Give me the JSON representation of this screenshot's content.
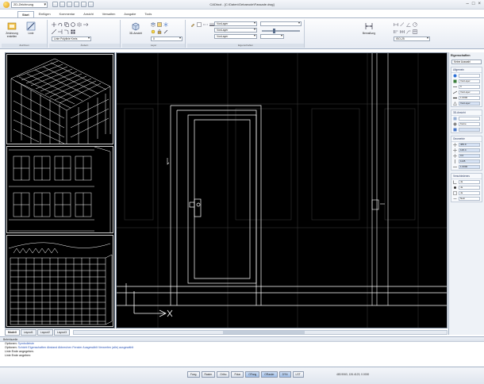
{
  "titlebar": {
    "workspace": "2D-Zeichnung",
    "title": "CADtool - [C:\\Daten\\Gebaeude\\Fassade.dwg]"
  },
  "ribbon": {
    "tabs": [
      "Start",
      "Einfügen",
      "Kommentar",
      "Ansicht",
      "Verwalten",
      "Ausgabe",
      "Tools"
    ],
    "active_tab": "Start",
    "groups": {
      "draw": {
        "title": "Zeichnen",
        "big1": "Zeichnung erstellen",
        "big2": "Linie"
      },
      "modify": {
        "title": "Ändern",
        "label": "Linie Polylinie Kreis"
      },
      "layer": {
        "title": "Layer",
        "big": "3D-Ansicht"
      },
      "properties": {
        "title": "Eigenschaften",
        "combo1": "0",
        "combo2": "VonLayer",
        "combo3": "VonLayer",
        "combo4": "VonLayer"
      },
      "annotation": {
        "big": "Bemaßung",
        "combo": "ISO-25"
      }
    }
  },
  "layout_tabs": [
    "Modell",
    "Layout1",
    "Layout2",
    "Layout3"
  ],
  "palette": {
    "title": "Eigenschaften",
    "selector": "Keine Auswahl",
    "sections": [
      {
        "title": "Allgemein",
        "rows": [
          "",
          "VonLayer",
          "0",
          "VonLayer",
          "1.0000",
          "VonLayer"
        ]
      },
      {
        "title": "3D-Ansicht",
        "rows": [
          "",
          "Keine",
          ""
        ]
      },
      {
        "title": "Geometrie",
        "rows": [
          "483.9",
          "126.4",
          "0.0",
          "1145",
          "1.0000"
        ]
      },
      {
        "title": "Verschiedenes",
        "rows": [
          "Ja",
          "Ja",
          "Ja",
          "Nein"
        ]
      }
    ]
  },
  "command": {
    "header": "Befehlszeile",
    "line1_prefix": "Optionen:",
    "line1_opts": "Symbolleiste",
    "line2_prefix": "Optionen:",
    "line2_opts": "Schicht Eigenschaften Abstand Abbrechen Fenster Ausgewählt Verwerfen (alle) ausgewählt",
    "line3": "Linie Ende angegeben.",
    "line4": "Linie Ende angeben:"
  },
  "status": {
    "buttons": [
      "Fang",
      "Raster",
      "Ortho",
      "Polar",
      "OFang",
      "ORaster",
      "DYN",
      "LST"
    ],
    "active": [
      "OFang",
      "ORaster",
      "DYN"
    ],
    "coords": "483.9063, 126.4123, 0.0000"
  },
  "colors": {
    "viewport_bg": "#000000",
    "linework": "#ffffff",
    "ribbon_border": "#a5b3c6",
    "link_blue": "#2a55b8"
  }
}
